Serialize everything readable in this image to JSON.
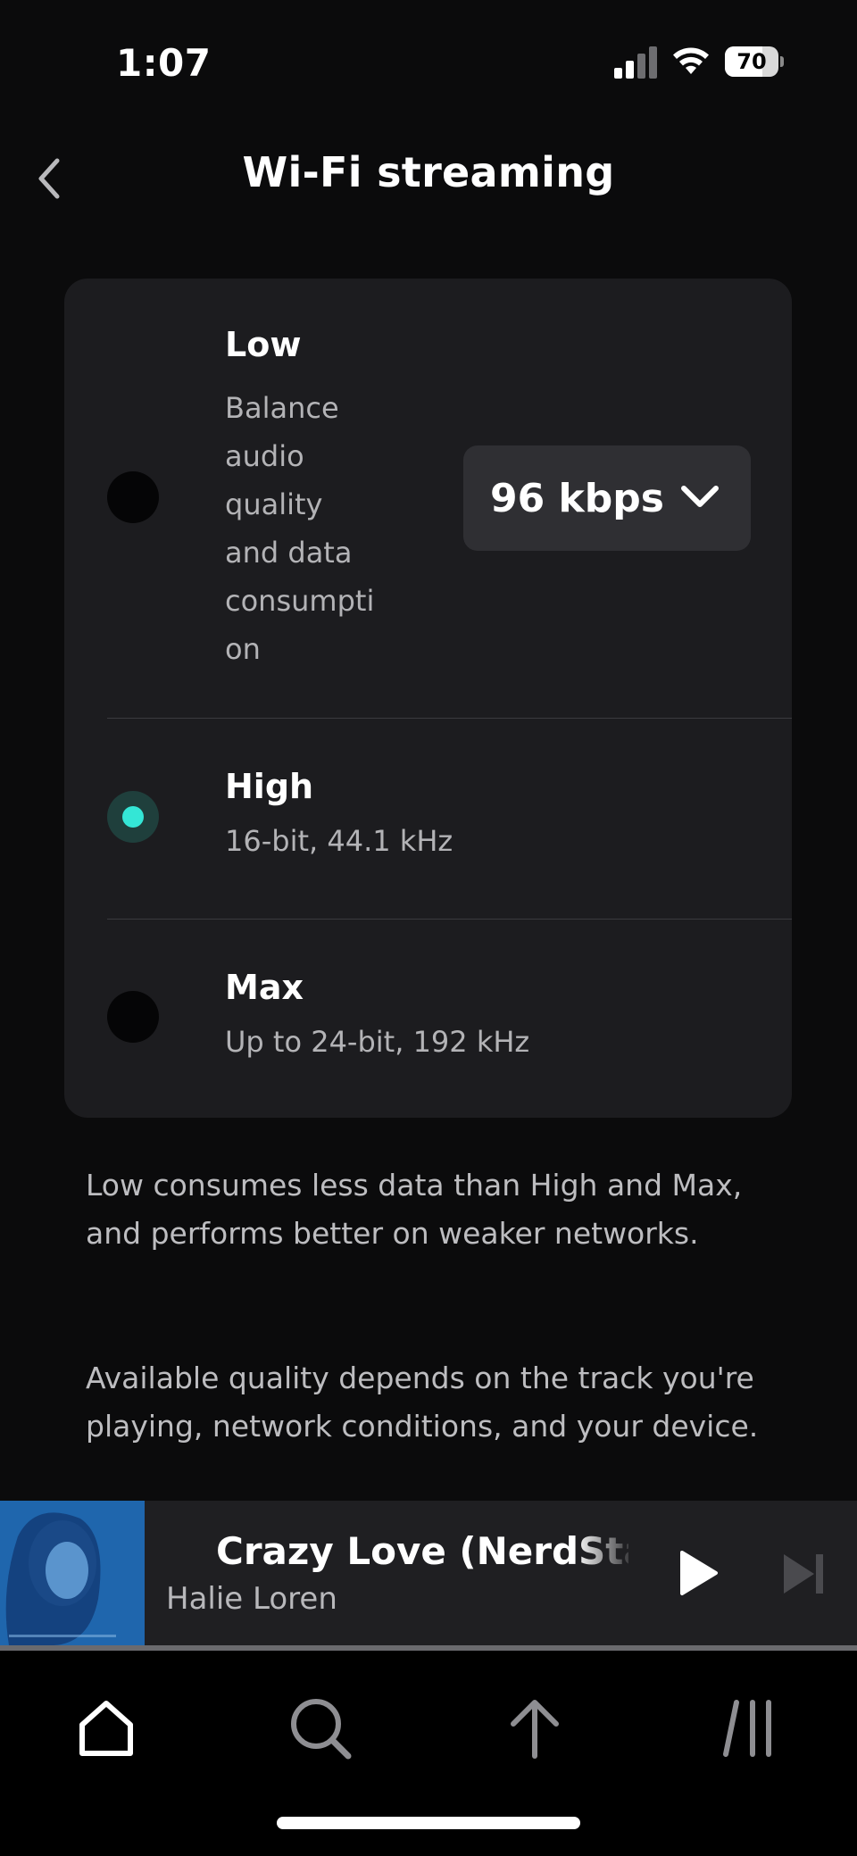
{
  "status_bar": {
    "time": "1:07",
    "battery_level": "70",
    "battery_fraction": 0.7
  },
  "header": {
    "title": "Wi-Fi streaming",
    "back_icon": "chevron-left-icon"
  },
  "options": [
    {
      "title": "Low",
      "subtitle_lines": [
        "Balance",
        "audio",
        "quality",
        "and data",
        "consumpti",
        "on"
      ],
      "selected": false,
      "bitrate_select": {
        "value": "96 kbps",
        "icon": "chevron-down-icon"
      }
    },
    {
      "title": "High",
      "subtitle": "16-bit, 44.1 kHz",
      "selected": true
    },
    {
      "title": "Max",
      "subtitle": "Up to 24-bit, 192 kHz",
      "selected": false
    }
  ],
  "info": {
    "paragraph_1": "Low consumes less data than High and Max, and performs better on weaker networks.",
    "paragraph_2": "Available quality depends on the track you're playing, network conditions, and your device."
  },
  "mini_player": {
    "track_title": "Crazy Love (NerdStar Remix)",
    "artist": "Halie Loren",
    "progress_fraction": 0,
    "play_icon": "play-icon",
    "skip_icon": "skip-next-icon"
  },
  "tab_bar": {
    "tabs": [
      {
        "icon": "home-icon",
        "active": true
      },
      {
        "icon": "search-icon",
        "active": false
      },
      {
        "icon": "upload-icon",
        "active": false
      },
      {
        "icon": "library-icon",
        "active": false
      }
    ]
  },
  "colors": {
    "accent": "#34e6d6",
    "background": "#0b0b0c",
    "card": "#1c1c1f"
  }
}
